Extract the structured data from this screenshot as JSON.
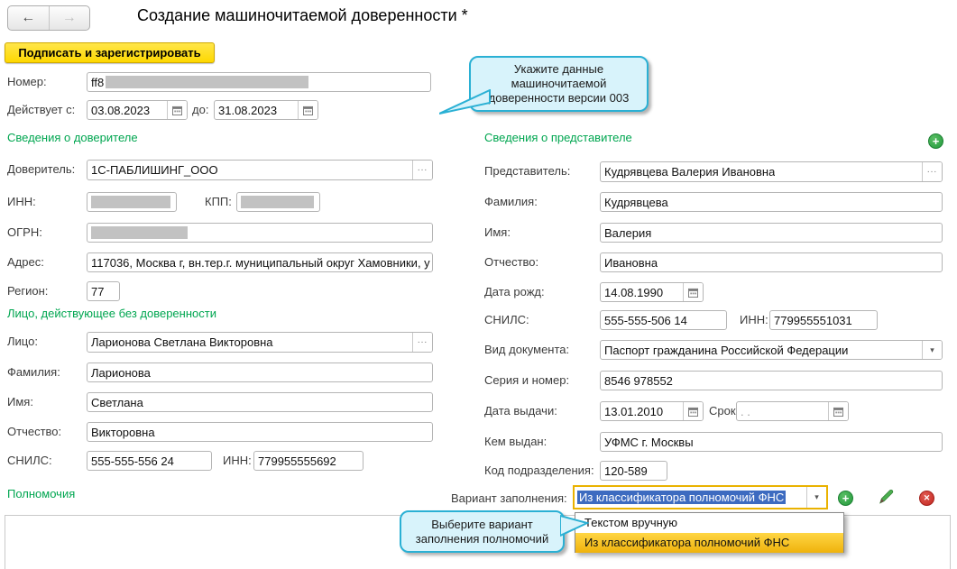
{
  "window": {
    "title": "Создание машиночитаемой доверенности *"
  },
  "icons": {
    "back": "←",
    "forward": "→",
    "ellipsis": "...",
    "dropdown_arrow": "▾",
    "plus": "+",
    "close": "✕"
  },
  "toolbar": {
    "sign_button": "Подписать и зарегистрировать"
  },
  "top": {
    "number": {
      "label": "Номер:",
      "value": "ff8"
    },
    "valid_from": {
      "label": "Действует с:",
      "value": "03.08.2023"
    },
    "valid_to": {
      "label": "до:",
      "value": "31.08.2023"
    }
  },
  "callouts": {
    "version": "Укажите данные машиночитаемой доверенности версии 003",
    "fill_variant": "Выберите вариант заполнения полномочий"
  },
  "principal": {
    "title": "Сведения о доверителе",
    "truster": {
      "label": "Доверитель:",
      "value": "1С-ПАБЛИШИНГ_ООО"
    },
    "inn": {
      "label": "ИНН:",
      "value": ""
    },
    "kpp": {
      "label": "КПП:",
      "value": ""
    },
    "ogrn": {
      "label": "ОГРН:",
      "value": ""
    },
    "address": {
      "label": "Адрес:",
      "value": "117036, Москва г, вн.тер.г. муниципальный округ Хамовники, у"
    },
    "region": {
      "label": "Регион:",
      "value": "77"
    }
  },
  "signer": {
    "title": "Лицо, действующее без доверенности",
    "person": {
      "label": "Лицо:",
      "value": "Ларионова Светлана Викторовна"
    },
    "surname": {
      "label": "Фамилия:",
      "value": "Ларионова"
    },
    "name": {
      "label": "Имя:",
      "value": "Светлана"
    },
    "patronymic": {
      "label": "Отчество:",
      "value": "Викторовна"
    },
    "snils": {
      "label": "СНИЛС:",
      "value": "555-555-556 24"
    },
    "inn": {
      "label": "ИНН:",
      "value": "779955555692"
    }
  },
  "representative": {
    "title": "Сведения о представителе",
    "person": {
      "label": "Представитель:",
      "value": "Кудрявцева Валерия Ивановна"
    },
    "surname": {
      "label": "Фамилия:",
      "value": "Кудрявцева"
    },
    "name": {
      "label": "Имя:",
      "value": "Валерия"
    },
    "patronymic": {
      "label": "Отчество:",
      "value": "Ивановна"
    },
    "birth_date": {
      "label": "Дата рожд:",
      "value": "14.08.1990"
    },
    "snils": {
      "label": "СНИЛС:",
      "value": "555-555-506 14"
    },
    "inn": {
      "label": "ИНН:",
      "value": "779955551031"
    },
    "doc_type": {
      "label": "Вид документа:",
      "value": "Паспорт гражданина Российской Федерации"
    },
    "series_number": {
      "label": "Серия и номер:",
      "value": "8546 978552"
    },
    "issue_date": {
      "label": "Дата выдачи:",
      "value": "13.01.2010"
    },
    "expiry": {
      "label": "Срок:",
      "value": ".  ."
    },
    "issued_by": {
      "label": "Кем выдан:",
      "value": "УФМС г. Москвы"
    },
    "department_code": {
      "label": "Код подразделения:",
      "value": "120-589"
    }
  },
  "powers": {
    "title": "Полномочия",
    "fill_variant_label": "Вариант заполнения:",
    "fill_variant_value": "Из классификатора полномочий ФНС",
    "options": [
      "Текстом вручную",
      "Из классификатора полномочий ФНС"
    ],
    "selected_option_index": 1
  },
  "colors": {
    "accent_yellow": "#ffdd00",
    "section_green": "#00a650",
    "selection_blue": "#3d6bc0",
    "option_highlight": "#f2bc1d",
    "callout_fill": "#d8f3fb",
    "callout_border": "#2ab0d4",
    "focus_border": "#eab200",
    "redaction_gray": "#c2c2c2"
  }
}
